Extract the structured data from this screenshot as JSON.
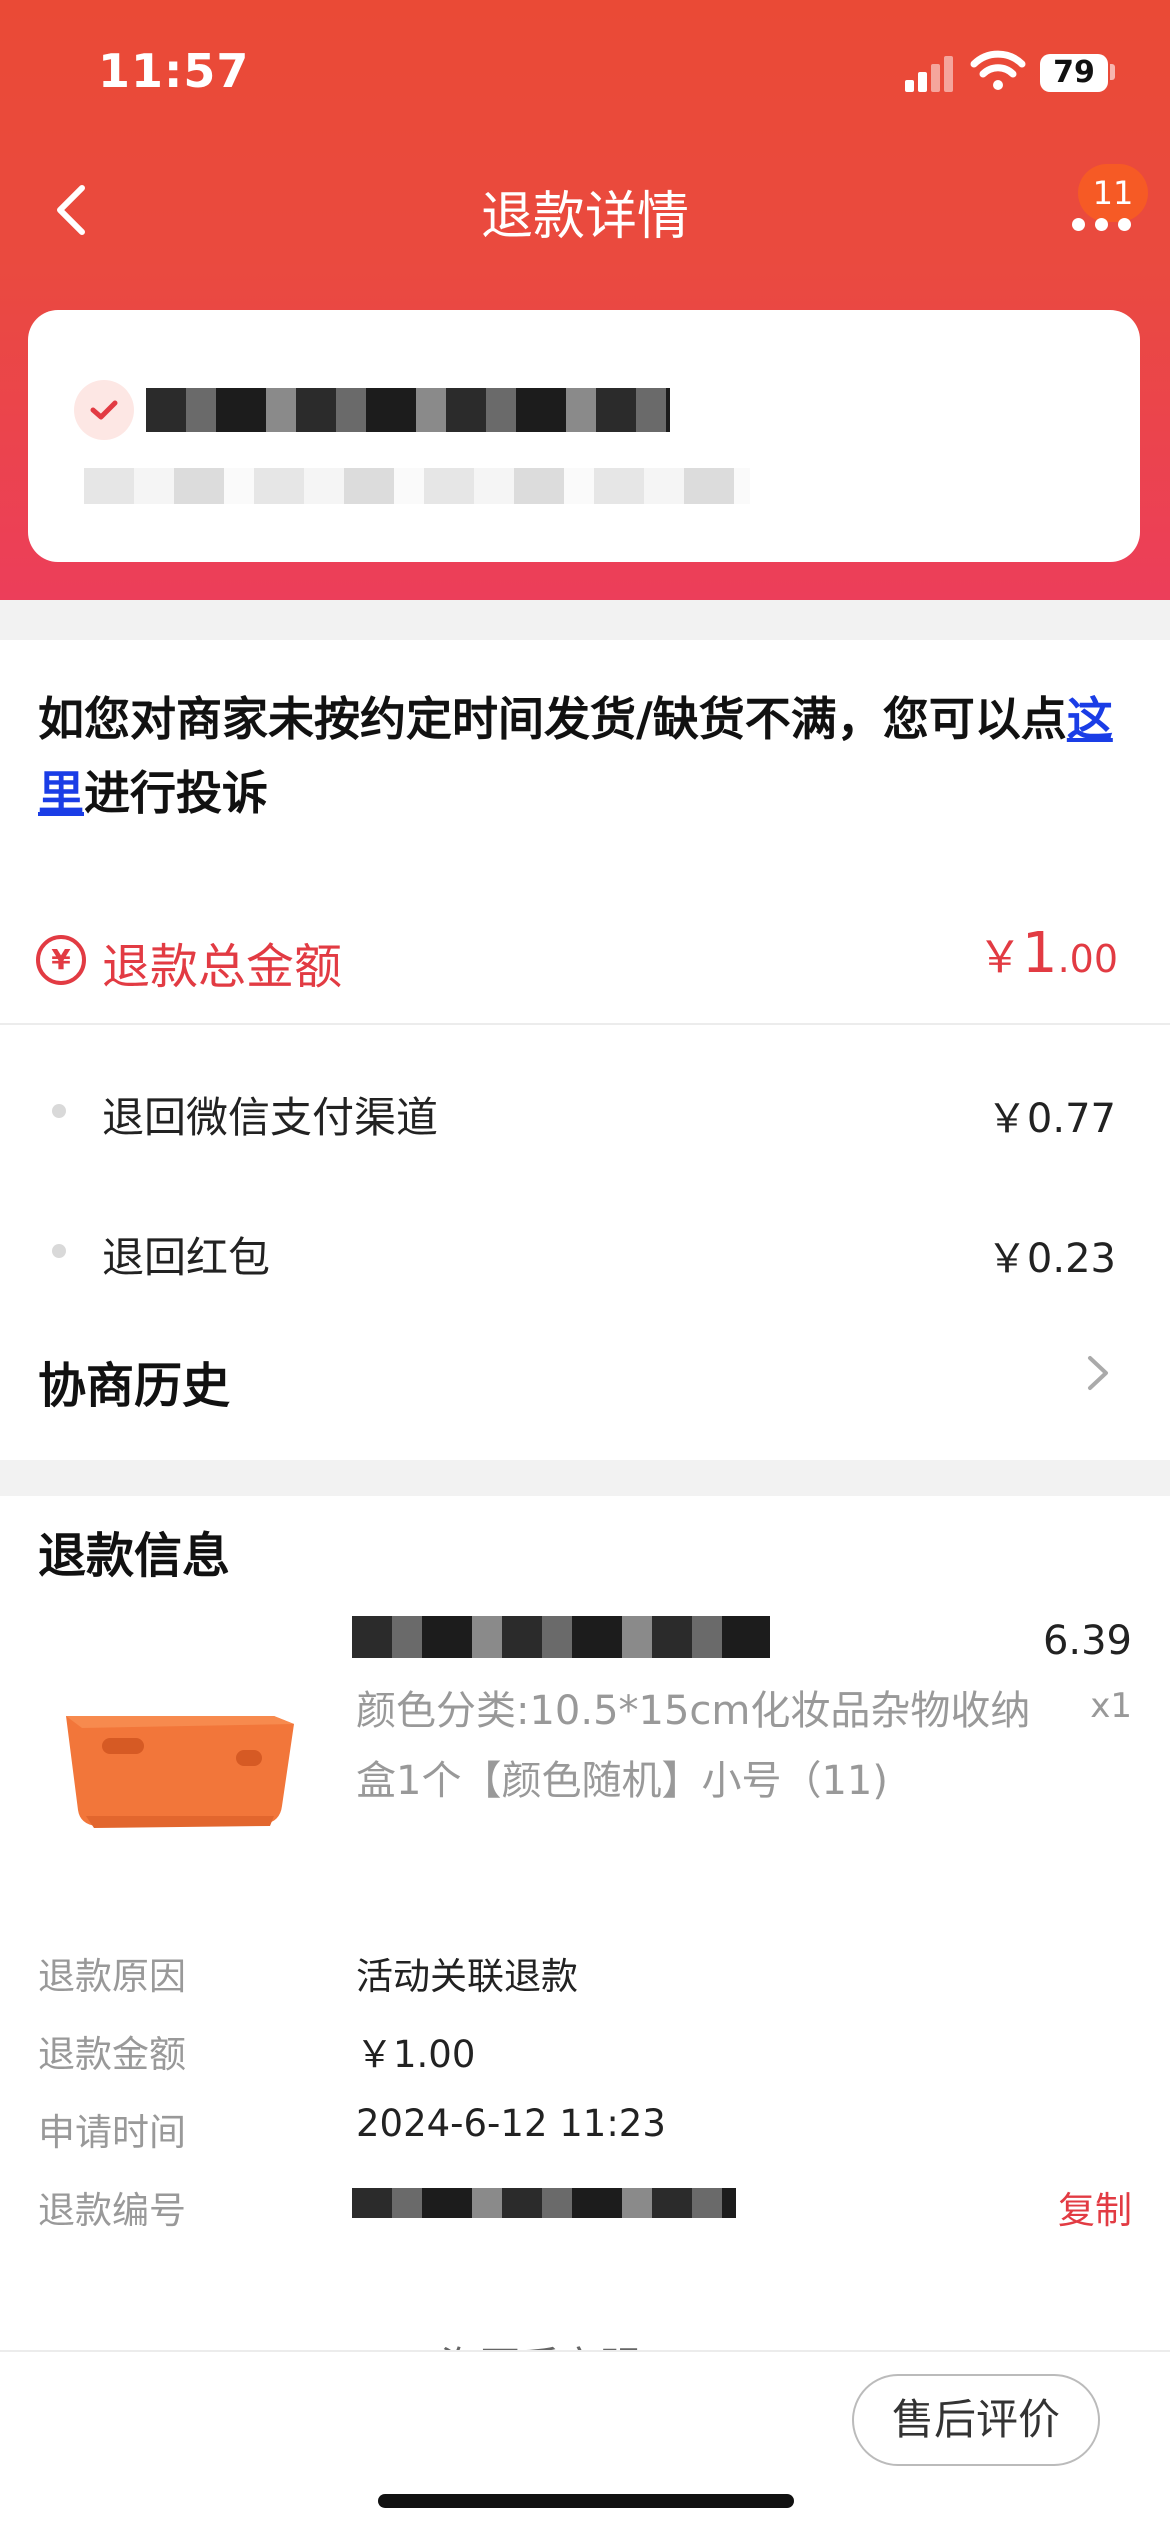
{
  "status_bar": {
    "time": "11:57",
    "battery": "79"
  },
  "nav": {
    "title": "退款详情",
    "badge": "11"
  },
  "complaint": {
    "text_before": "如您对商家未按约定时间发货/缺货不满，您可以点",
    "link": "这里",
    "text_after": "进行投诉"
  },
  "total": {
    "label": "退款总金额",
    "currency": "￥",
    "integer": "1",
    "decimal": ".00"
  },
  "breakdown": [
    {
      "label": "退回微信支付渠道",
      "amount": "￥0.77"
    },
    {
      "label": "退回红包",
      "amount": "￥0.23"
    }
  ],
  "history": {
    "label": "协商历史"
  },
  "refund_info": {
    "title": "退款信息",
    "product": {
      "price": "6.39",
      "quantity": "x1",
      "spec": "颜色分类:10.5*15cm化妆品杂物收纳盒1个【颜色随机】小号（11)"
    },
    "fields": [
      {
        "key": "退款原因",
        "value": "活动关联退款"
      },
      {
        "key": "退款金额",
        "value": "￥1.00"
      },
      {
        "key": "申请时间",
        "value": "2024-6-12 11:23"
      },
      {
        "key": "退款编号",
        "value": ""
      }
    ],
    "copy_label": "复制",
    "peek_text": "海页后安明"
  },
  "bottom": {
    "review_button": "售后评价"
  },
  "colors": {
    "accent": "#e23b43",
    "header_top": "#ea4a36",
    "header_bottom": "#ec3e5a",
    "link": "#1a3de6"
  }
}
